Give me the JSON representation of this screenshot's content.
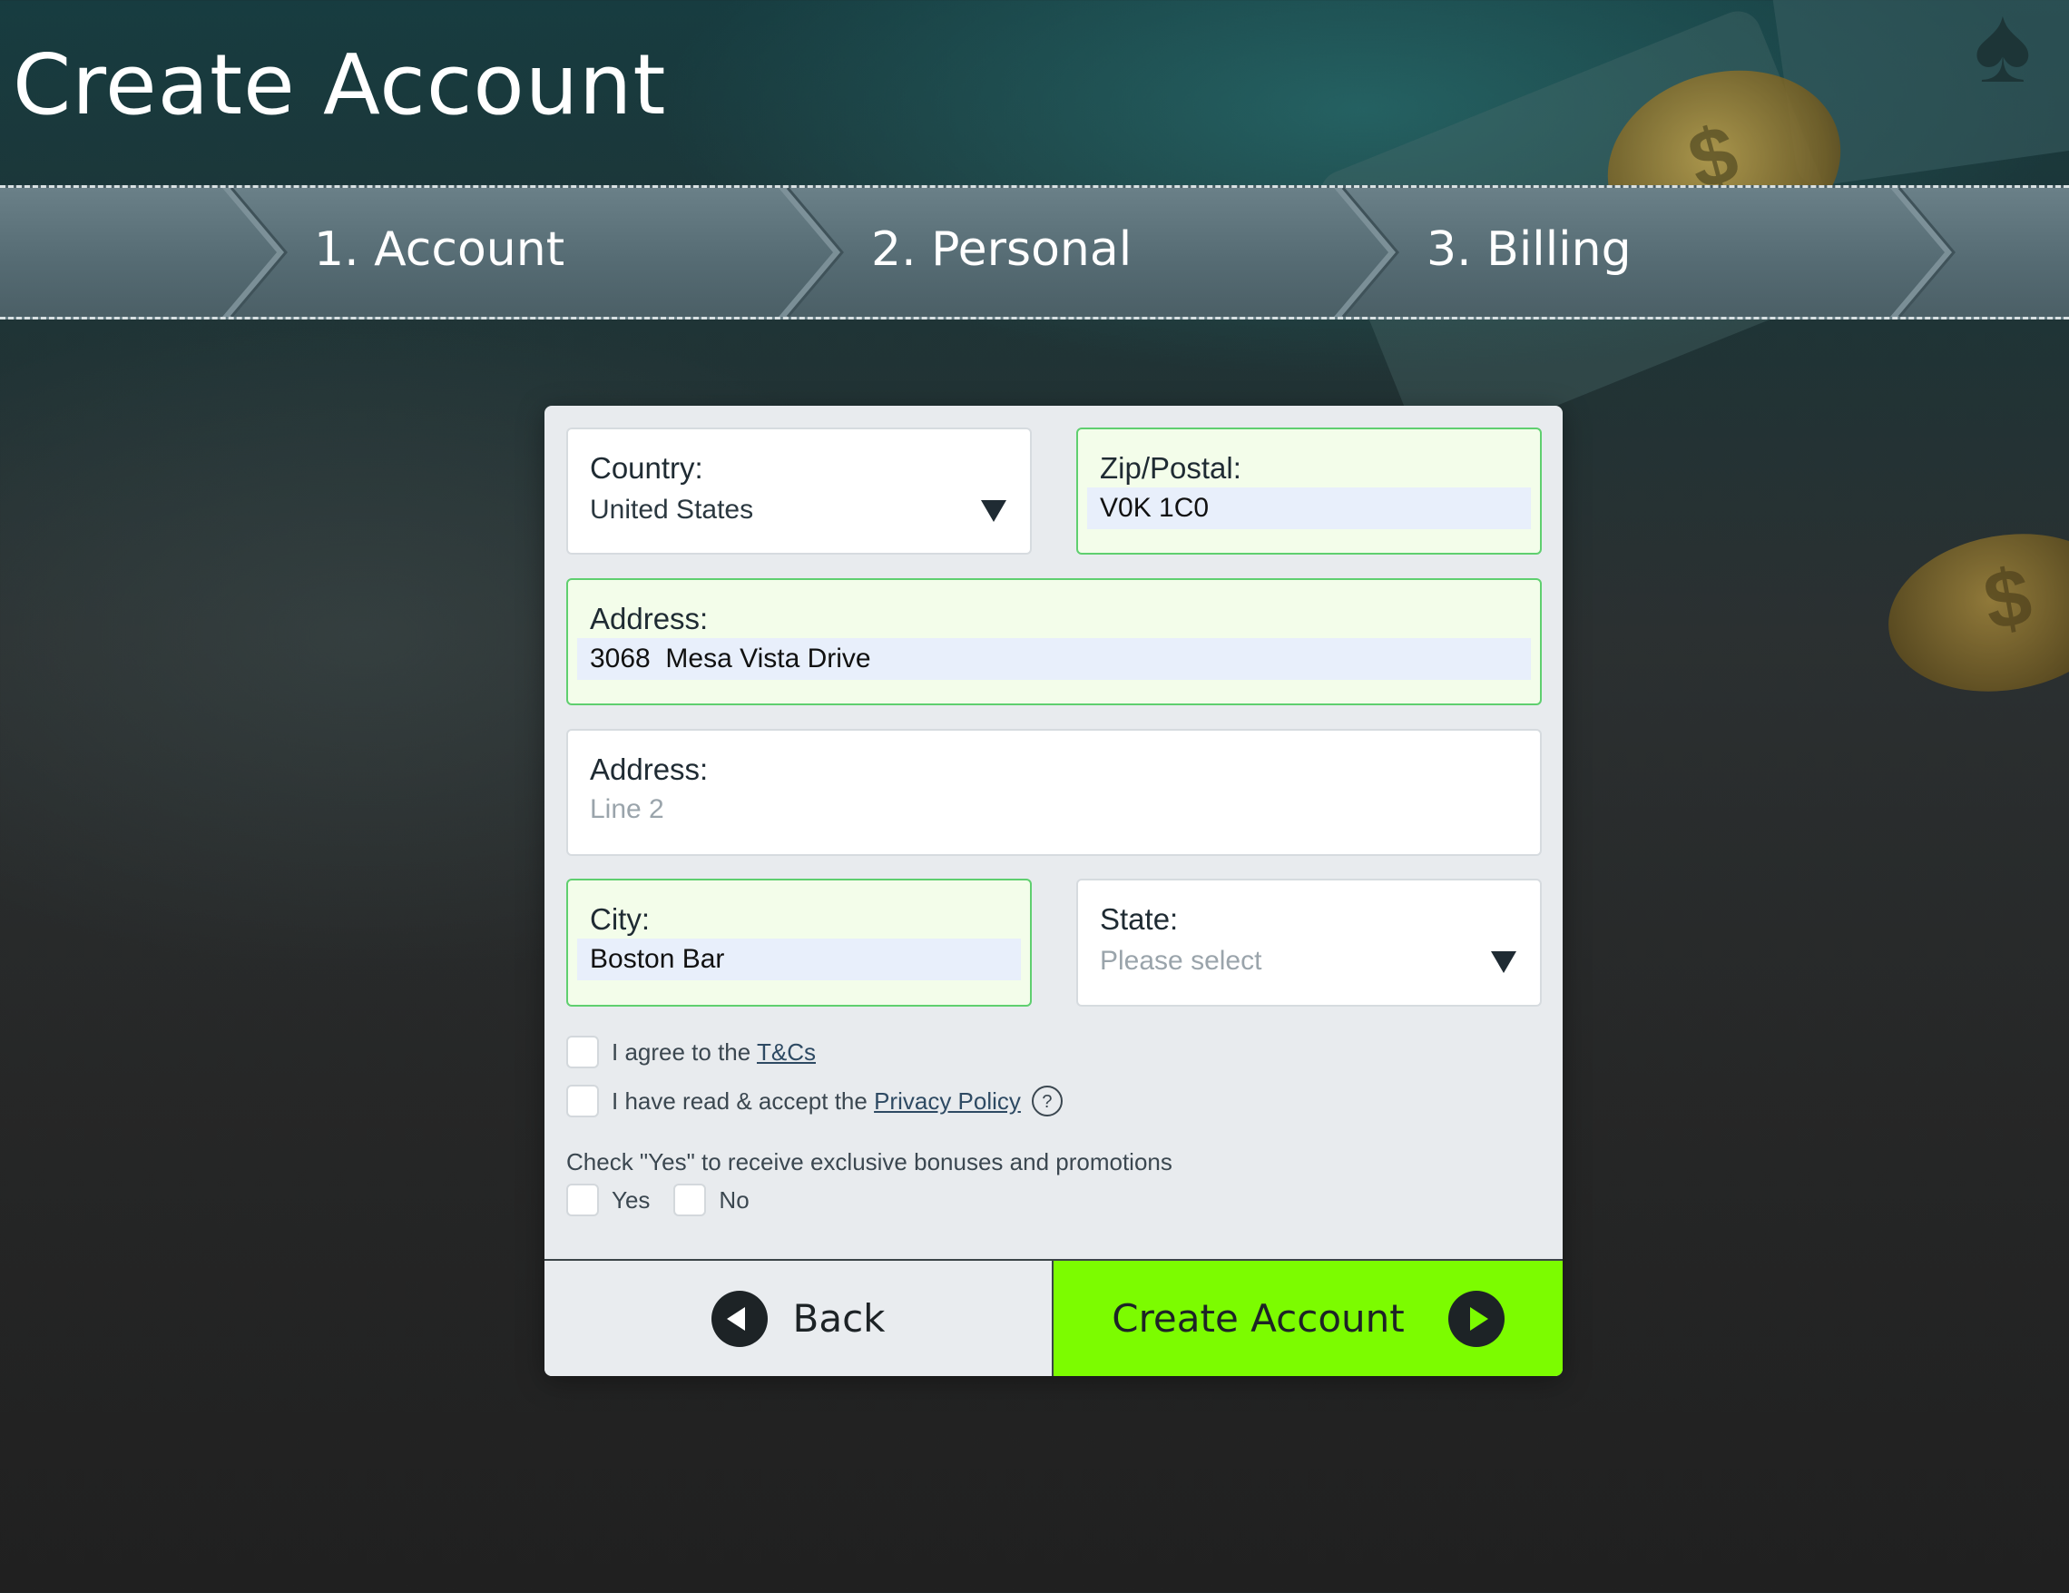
{
  "page": {
    "title": "Create Account"
  },
  "steps": [
    {
      "label": "1. Account"
    },
    {
      "label": "2. Personal"
    },
    {
      "label": "3. Billing"
    }
  ],
  "form": {
    "country": {
      "label": "Country:",
      "value": "United States"
    },
    "zip": {
      "label": "Zip/Postal:",
      "value": "V0K 1C0"
    },
    "address1": {
      "label": "Address:",
      "value": "3068  Mesa Vista Drive"
    },
    "address2": {
      "label": "Address:",
      "placeholder": "Line 2"
    },
    "city": {
      "label": "City:",
      "value": "Boston Bar"
    },
    "state": {
      "label": "State:",
      "placeholder": "Please select"
    },
    "terms": {
      "prefix": "I agree to the ",
      "link": "T&Cs"
    },
    "privacy": {
      "prefix": "I have read & accept the ",
      "link": "Privacy Policy",
      "help": "?"
    },
    "promo": {
      "text": "Check \"Yes\" to receive exclusive bonuses and promotions",
      "yes": "Yes",
      "no": "No"
    }
  },
  "buttons": {
    "back": "Back",
    "create": "Create Account"
  },
  "colors": {
    "accent": "#7cfc00",
    "valid_border": "#5fcf6f",
    "card_bg": "#e8ebee"
  },
  "icons": {
    "select_caret": "caret-down-icon",
    "back": "back-arrow-icon",
    "next": "next-arrow-icon",
    "help": "help-icon"
  }
}
